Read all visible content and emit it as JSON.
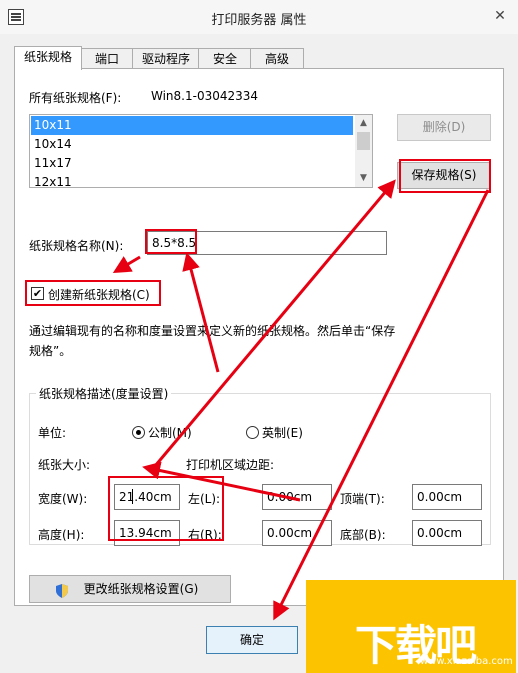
{
  "window": {
    "title": "打印服务器 属性",
    "close_glyph": "✕",
    "icon": "printer-server-icon"
  },
  "tabs": [
    {
      "label": "纸张规格"
    },
    {
      "label": "端口"
    },
    {
      "label": "驱动程序"
    },
    {
      "label": "安全"
    },
    {
      "label": "高级"
    }
  ],
  "forms": {
    "all_forms_label": "所有纸张规格(F):",
    "server_name": "Win8.1-03042334",
    "list": [
      "10x11",
      "10x14",
      "11x17",
      "12x11"
    ],
    "selected_index": 0,
    "delete_button": "删除(D)",
    "save_button": "保存规格(S)",
    "form_name_label": "纸张规格名称(N):",
    "form_name_value": "8.5*8.5",
    "create_new_label": "创建新纸张规格(C)",
    "create_new_checked": true,
    "description": "通过编辑现有的名称和度量设置来定义新的纸张规格。然后单击“保存规格”。"
  },
  "measurements": {
    "group_label": "纸张规格描述(度量设置)",
    "units_label": "单位:",
    "metric_label": "公制(M)",
    "english_label": "英制(E)",
    "metric_selected": true,
    "paper_size_label": "纸张大小:",
    "margins_label": "打印机区域边距:",
    "width_label": "宽度(W):",
    "width_value": "21.40cm",
    "height_label": "高度(H):",
    "height_value": "13.94cm",
    "left_label": "左(L):",
    "left_value": "0.00cm",
    "right_label": "右(R):",
    "right_value": "0.00cm",
    "top_label": "顶端(T):",
    "top_value": "0.00cm",
    "bottom_label": "底部(B):",
    "bottom_value": "0.00cm"
  },
  "change_settings_button": "更改纸张规格设置(G)",
  "ok_button": "确定",
  "scroll": {
    "up": "▲",
    "down": "▼"
  },
  "colors": {
    "highlight": "#3399ff",
    "annotation_red": "#e60012",
    "watermark_orange": "#fcc300"
  },
  "watermark": {
    "text": "下载吧",
    "url": "www.xiazaiba.com"
  }
}
